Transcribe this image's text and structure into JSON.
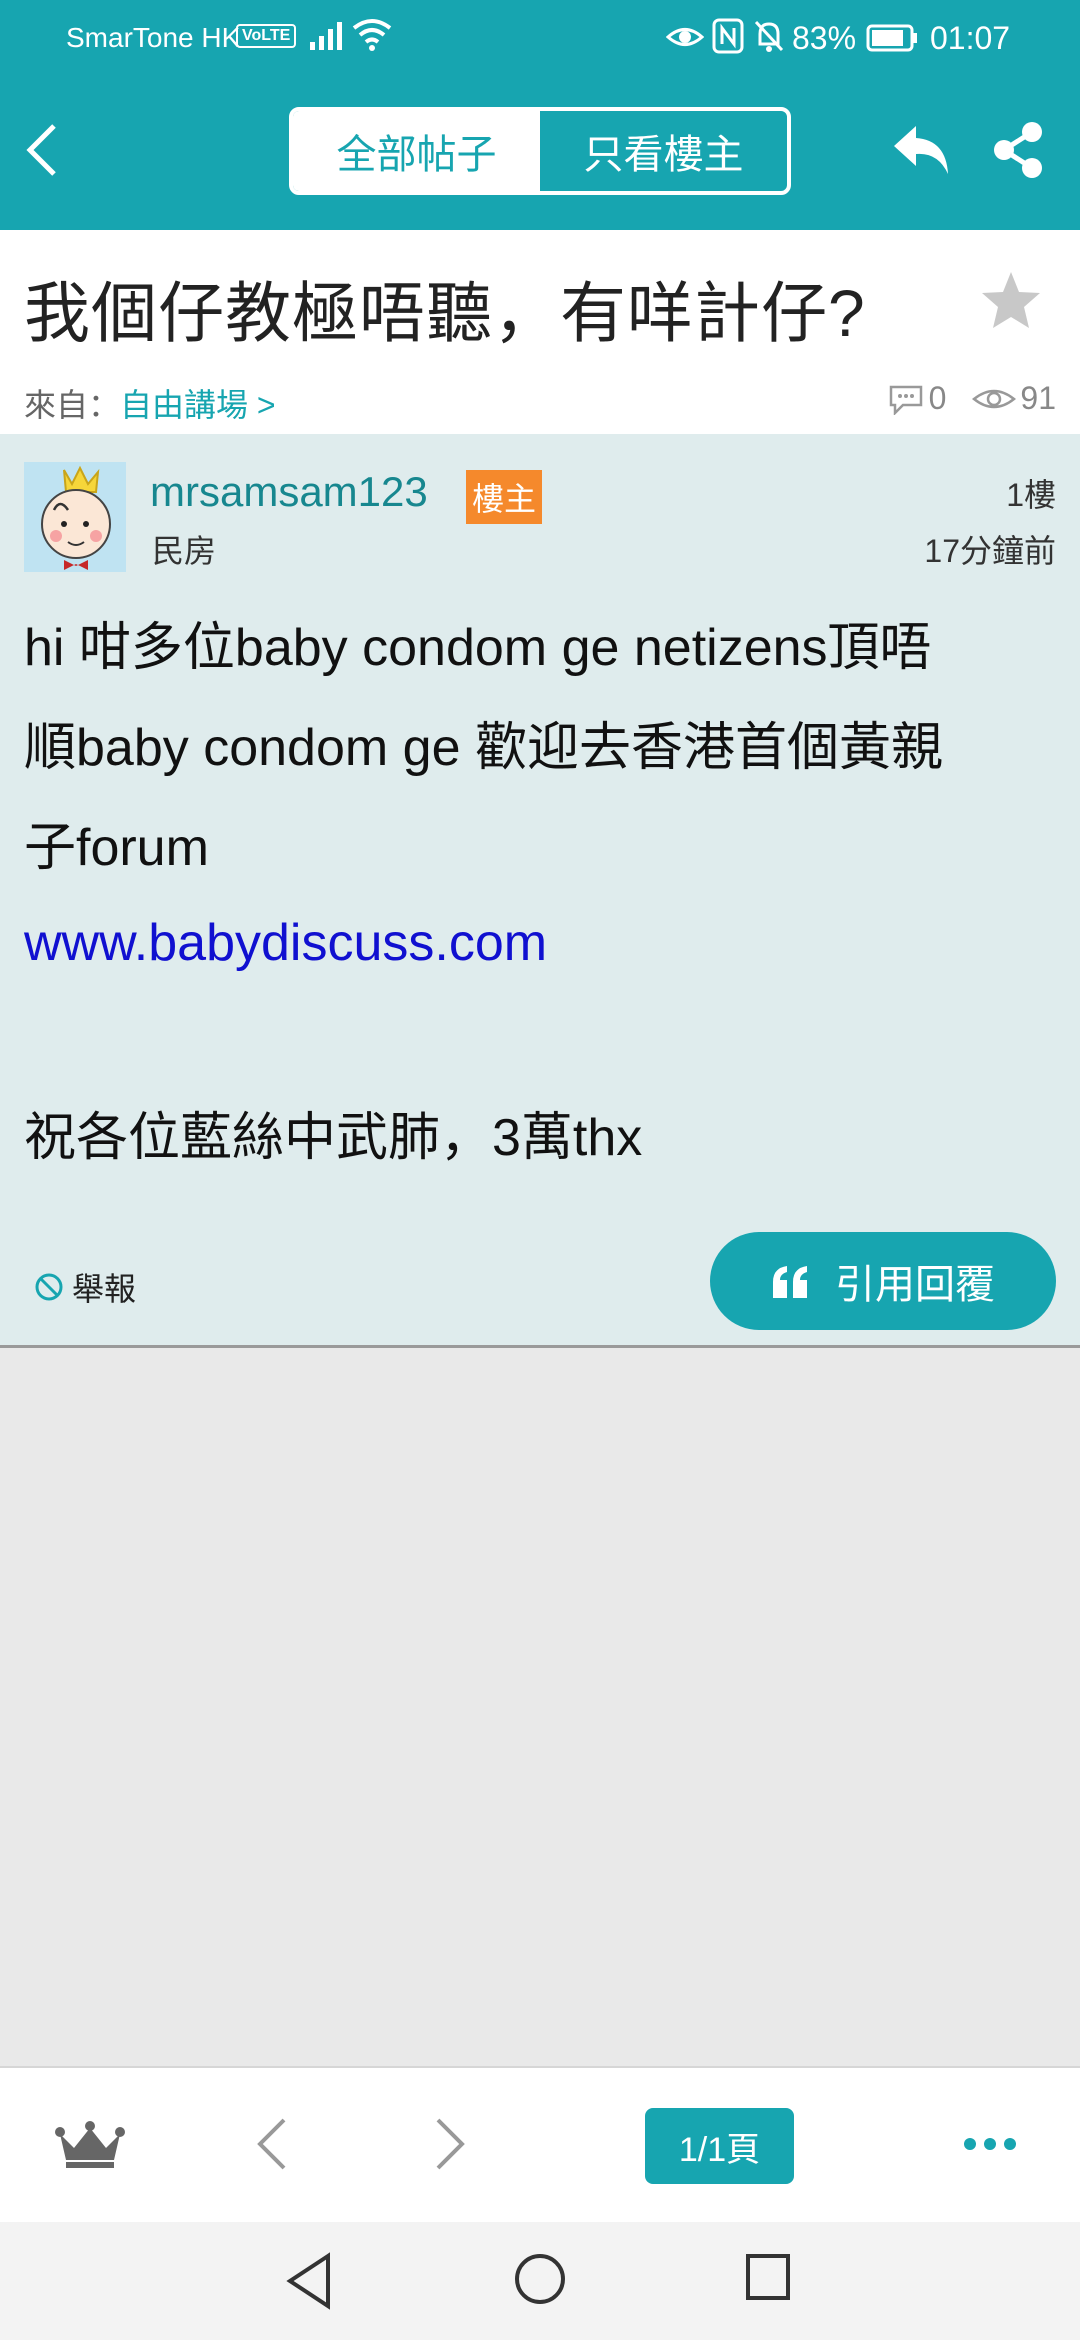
{
  "status_bar": {
    "carrier": "SmarTone HK",
    "volte": "VoLTE",
    "battery": "83%",
    "time": "01:07"
  },
  "header": {
    "tabs": [
      {
        "label": "全部帖子",
        "active": true
      },
      {
        "label": "只看樓主",
        "active": false
      }
    ],
    "accent_color": "#17a5b0"
  },
  "post_title": "我個仔教極唔聽，有咩計仔?",
  "meta": {
    "from_label": "來自：",
    "forum_name": "自由講場 >",
    "comments": "0",
    "views": "91"
  },
  "post": {
    "username": "mrsamsam123",
    "op_badge": "樓主",
    "rank": "民房",
    "floor": "1樓",
    "time": "17分鐘前",
    "body_line1": "hi 咁多位baby condom ge netizens頂唔",
    "body_line2": "順baby condom ge 歡迎去香港首個黃親",
    "body_line3": "子forum",
    "link": "www.babydiscuss.com",
    "body_line4": "祝各位藍絲中武肺，3萬thx",
    "report_label": "舉報",
    "quote_label": "引用回覆"
  },
  "bottom_nav": {
    "page_label": "1/1頁"
  }
}
